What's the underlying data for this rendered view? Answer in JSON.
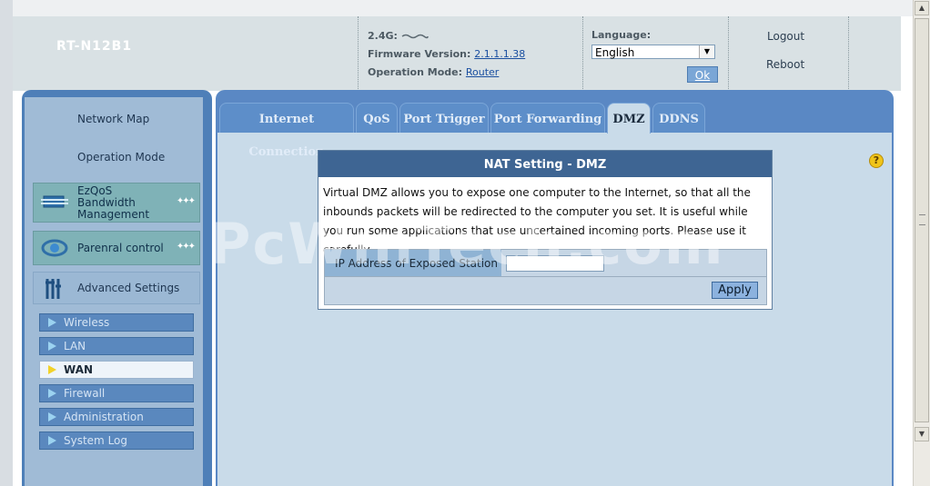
{
  "header": {
    "model": "RT-N12B1",
    "band_label": "2.4G:",
    "firmware_label": "Firmware Version:",
    "firmware_value": "2.1.1.1.38",
    "mode_label": "Operation Mode:",
    "mode_value": "Router",
    "language_label": "Language:",
    "language_value": "English",
    "ok_label": "Ok",
    "logout_label": "Logout",
    "reboot_label": "Reboot"
  },
  "sidebar": {
    "network_map": "Network Map",
    "operation_mode": "Operation Mode",
    "ezqos_line1": "EzQoS",
    "ezqos_line2": "Bandwidth",
    "ezqos_line3": "Management",
    "parental": "Parenral control",
    "advanced": "Advanced Settings",
    "subitems": [
      "Wireless",
      "LAN",
      "WAN",
      "Firewall",
      "Administration",
      "System Log"
    ]
  },
  "tabs": [
    "Internet Connection",
    "QoS",
    "Port Trigger",
    "Port Forwarding",
    "DMZ",
    "DDNS"
  ],
  "panel": {
    "title": "NAT Setting - DMZ",
    "description": "Virtual DMZ allows you to expose one computer to the Internet, so that all the inbounds packets will be redirected to the computer you set. It is useful while you run some applications that use uncertained incoming ports. Please use it carefully.",
    "ip_label": "IP Address of Exposed Station",
    "ip_value": "",
    "apply_label": "Apply"
  },
  "watermark": "PcWinTech.com",
  "colors": {
    "accent": "#3e6593",
    "tab_bg": "#5d8ec9",
    "content_bg": "#c9dbe9",
    "sidebar_bg": "#4e7fb8"
  }
}
